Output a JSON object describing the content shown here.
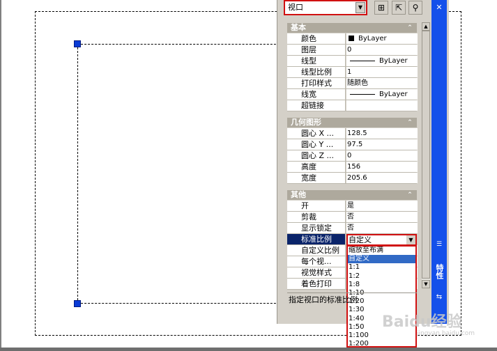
{
  "object_type_select": {
    "value": "视口"
  },
  "toolbar": {
    "quick_select_icon": "quick-select-icon",
    "pickadd_icon": "pickadd-icon",
    "filter_icon": "filter-icon"
  },
  "sections": {
    "basic": {
      "title": "基本",
      "rows": [
        {
          "label": "颜色",
          "value": "ByLayer"
        },
        {
          "label": "图层",
          "value": "0"
        },
        {
          "label": "线型",
          "value": "ByLayer"
        },
        {
          "label": "线型比例",
          "value": "1"
        },
        {
          "label": "打印样式",
          "value": "随颜色"
        },
        {
          "label": "线宽",
          "value": "ByLayer"
        },
        {
          "label": "超链接",
          "value": ""
        }
      ]
    },
    "geometry": {
      "title": "几何图形",
      "rows": [
        {
          "label": "圆心 X ...",
          "value": "128.5"
        },
        {
          "label": "圆心 Y ...",
          "value": "97.5"
        },
        {
          "label": "圆心 Z ...",
          "value": "0"
        },
        {
          "label": "高度",
          "value": "156"
        },
        {
          "label": "宽度",
          "value": "205.6"
        }
      ]
    },
    "misc": {
      "title": "其他",
      "rows": [
        {
          "label": "开",
          "value": "是"
        },
        {
          "label": "剪裁",
          "value": "否"
        },
        {
          "label": "显示锁定",
          "value": "否"
        },
        {
          "label": "标准比例",
          "value": "自定义"
        },
        {
          "label": "自定义比例",
          "value": ""
        },
        {
          "label": "每个视...",
          "value": ""
        },
        {
          "label": "视觉样式",
          "value": ""
        },
        {
          "label": "着色打印",
          "value": ""
        }
      ]
    }
  },
  "scale_options": [
    "缩放至布满",
    "自定义",
    "1:1",
    "1:2",
    "1:8",
    "1:10",
    "1:20",
    "1:30",
    "1:40",
    "1:50",
    "1:100",
    "1:200"
  ],
  "selected_scale": "自定义",
  "description": "指定视口的标准比例",
  "palette_title": "特性",
  "watermark": {
    "brand": "Baidu经验",
    "url": "jingyan.baidu.com"
  },
  "colors": {
    "selection_red": "#d01010",
    "grip_blue": "#0a3bd6",
    "titlebar_blue": "#1450ea",
    "highlight": "#316ac5"
  }
}
